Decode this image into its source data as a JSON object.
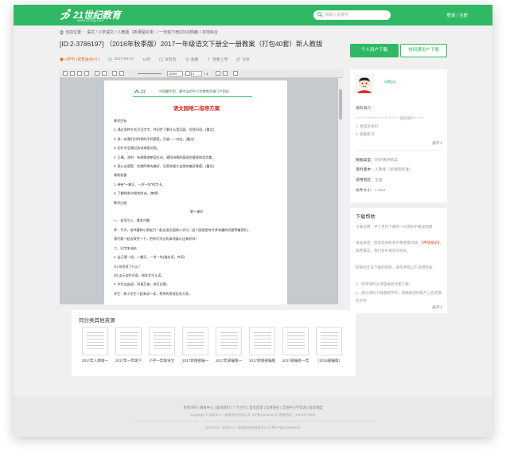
{
  "header": {
    "logo_text": "21世纪教育",
    "logo_url": "www.21cnjy.com",
    "search_placeholder": "请输入关键字",
    "login": "登录",
    "sep": "/",
    "register": "注册"
  },
  "breadcrumb": {
    "prefix": "当前位置：",
    "path": "语文 / 小学语文 / 人教版（新课程标准）/ 一年级下册(2016部编) / 本地综合"
  },
  "document": {
    "title": "[ID:2-3786197] （2016年秋季版）2017一年级语文下册全一册教案（打包40套）新人教版",
    "points": "0学币 (或普通点0个)",
    "date": "2017-06-22",
    "pages": "19页",
    "type": "资料包",
    "fav": "收藏",
    "upload": "我要上传",
    "share": "分享"
  },
  "actions": {
    "personal_download": "个人用户下载",
    "school_download": "校网通用户下载"
  },
  "viewer": {
    "zoom": "100%",
    "page_current": "1",
    "page_total": "/ 4",
    "org": "中国最大型、最专业的中小学教育资源门户网站",
    "doc_heading": "语文园地二指导方案",
    "lines": [
      "教学目标",
      "1. 通过多种方式识记生字，并初步了解什么是品德、形状词语。(重点)",
      "2. 说一说我们对四季的不同感受。开展一一对应。(重点)",
      "3. 初步学会通过选词来组词语。",
      "4. 正确、流利、有感情地朗读古诗，感悟诗歌所展现的意境和语言美。",
      "5. 用心去感受、欣赏四季的美好，培养热爱大自然的美好情感。(重点)",
      "课前准备",
      "1. 带有“一撇又、一岁一年”的字卡。",
      "2. 了解和季节相关的诗。(教师)",
      "教学过程",
      "第一课时",
      "一、谈话引入，激发兴趣",
      "师：今天，老师要和小朋友们一起去语文园地二学习，这个园地里有许多有趣的问题等着我们。",
      "我们要一起去探究一下，把你们学过的本领展示出来好吗？",
      "二、识字加油站",
      "1. 出示第一组：一撇又、一岁一年(指名读，齐读)",
      "(1) 你发现了什么？",
      "(2) 出示这些词语，指导学生认读。",
      "2. 学生自由读，同桌互查，进行比赛。",
      "学生：和小学生一起来读一读，把你的发现告诉大家。"
    ],
    "section_center_index": 10
  },
  "related": {
    "title": "同分类其他资源",
    "items": [
      "2017年人教版一年级语文",
      "2017年一年级下册语文知识点归纳",
      "小学一年级语文下册复习资料",
      "2017新版部编一年级下册",
      "2017年部编版一年级语文",
      "2017新版部编版一年级下册",
      "2017部编本一年级语文",
      "（2016部编版）2017"
    ]
  },
  "uploader": {
    "name": "sdljyz",
    "intro_label": "资料简介：",
    "intro_lines": [
      "* * * * * * * * * * * * * * * * * * 资料简介 * * * *",
      "1.  教案及资料",
      "2.  配套练习"
    ],
    "more": "展开 ▾",
    "info": [
      {
        "label": "数据类型：",
        "value": "同步精讲教案"
      },
      {
        "label": "资料版本：",
        "value": "人教版（新课程标准）"
      },
      {
        "label": "适用地区：",
        "value": "全国"
      },
      {
        "label": "文件大小：",
        "value": "4.86M"
      }
    ]
  },
  "help": {
    "title": "下载帮助",
    "p1": "下载说明：半个月内下载同一份资料不重复扣费",
    "p2": "本站承诺：若发现资料有严重质量问题，",
    "p2_red": "【申请投诉】",
    "p2_tail": "，如若属实，我们会补偿您的损失。",
    "p3": "如果您无法下载到资料，请先参照以下说明检查：",
    "p4": "1、所有资料必须登录后才能下载。",
    "p5": "2、部分资料下载需要学币，请确保您的账户上有足够的学币",
    "more": "展开 ▾"
  },
  "footer": {
    "links": "免责声明 | 教育中心 | 联系我们 | 广告合作 | 意见反馈 | 友情链接 | 全国中小学资源 | 投诉制度",
    "line1": "Copyright © 深圳市二一教育股份有限公司 ICP备12011001号 客服热线：400-637-9991",
    "line2": "2006-2017 深圳市二一教育科技有限责任公司 粤ICP备11058694号"
  }
}
